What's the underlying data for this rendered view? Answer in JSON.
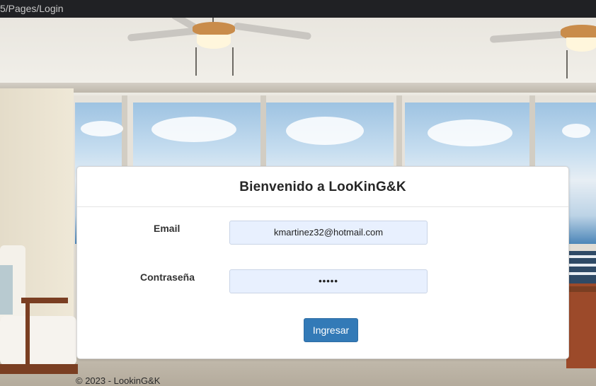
{
  "browser": {
    "url_fragment": "5/Pages/Login"
  },
  "login": {
    "title": "Bienvenido a LooKinG&K",
    "email_label": "Email",
    "email_value": "kmartinez32@hotmail.com",
    "password_label": "Contraseña",
    "password_value": "•••••",
    "submit_label": "Ingresar"
  },
  "footer": {
    "copyright": "© 2023 - LookinG&K"
  },
  "colors": {
    "button": "#337ab7",
    "input_autofill": "#e8f0fe",
    "urlbar": "#202124"
  }
}
